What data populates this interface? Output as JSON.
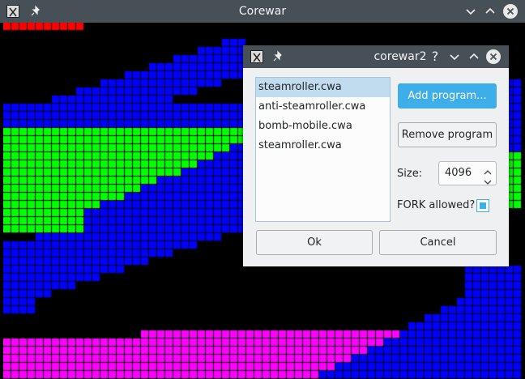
{
  "window": {
    "title": "Corewar",
    "app_icon": "corewar-app-icon",
    "pin_icon": "pin-icon"
  },
  "dialog": {
    "title": "corewar2",
    "programs": [
      {
        "label": "steamroller.cwa",
        "selected": true
      },
      {
        "label": "anti-steamroller.cwa",
        "selected": false
      },
      {
        "label": "bomb-mobile.cwa",
        "selected": false
      },
      {
        "label": "steamroller.cwa",
        "selected": false
      }
    ],
    "add_button": "Add program...",
    "remove_button": "Remove program",
    "size_label": "Size:",
    "size_value": "4096",
    "fork_label": "FORK allowed?",
    "fork_checked": true,
    "ok_button": "Ok",
    "cancel_button": "Cancel",
    "help_glyph": "?"
  },
  "colors": {
    "red": "#ff0000",
    "blue": "#0000ff",
    "green": "#00ff00",
    "magenta": "#ff00ff",
    "yellow": "#ffff00",
    "accent": "#3daee9"
  }
}
